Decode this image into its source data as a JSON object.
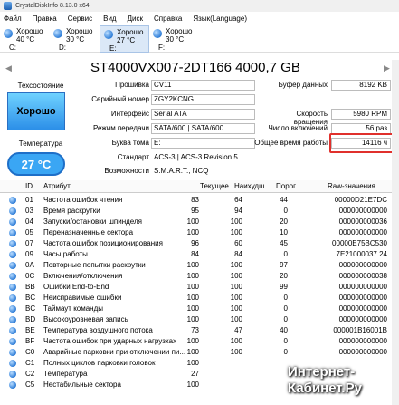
{
  "window": {
    "title": "CrystalDiskInfo 8.13.0 x64"
  },
  "menu": [
    "Файл",
    "Правка",
    "Сервис",
    "Вид",
    "Диск",
    "Справка",
    "Язык(Language)"
  ],
  "drives": [
    {
      "status": "Хорошо",
      "temp": "40 °C",
      "letter": "C:"
    },
    {
      "status": "Хорошо",
      "temp": "30 °C",
      "letter": "D:"
    },
    {
      "status": "Хорошо",
      "temp": "27 °C",
      "letter": "E:"
    },
    {
      "status": "Хорошо",
      "temp": "30 °C",
      "letter": "F:"
    }
  ],
  "model": "ST4000VX007-2DT166 4000,7 GB",
  "health": {
    "label": "Техсостояние",
    "value": "Хорошо"
  },
  "temperature": {
    "label": "Температура",
    "value": "27 °C"
  },
  "info": {
    "firmware_k": "Прошивка",
    "firmware_v": "CV11",
    "serial_k": "Серийный номер",
    "serial_v": "ZGY2KCNG",
    "interface_k": "Интерфейс",
    "interface_v": "Serial ATA",
    "transfer_k": "Режим передачи",
    "transfer_v": "SATA/600 | SATA/600",
    "volume_k": "Буква тома",
    "volume_v": "E:",
    "standard_k": "Стандарт",
    "standard_v": "ACS-3 | ACS-3 Revision 5",
    "features_k": "Возможности",
    "features_v": "S.M.A.R.T., NCQ",
    "buffer_k": "Буфер данных",
    "buffer_v": "8192 KB",
    "rotation_k": "Скорость вращения",
    "rotation_v": "5980 RPM",
    "poweron_k": "Число включений",
    "poweron_v": "56 раз",
    "hours_k": "Общее время работы",
    "hours_v": "14116 ч"
  },
  "table": {
    "headers": {
      "id": "ID",
      "attr": "Атрибут",
      "cur": "Текущее",
      "worst": "Наихудш...",
      "thr": "Порог",
      "raw": "Raw-значения"
    },
    "rows": [
      {
        "id": "01",
        "attr": "Частота ошибок чтения",
        "cur": "83",
        "worst": "64",
        "thr": "44",
        "raw": "00000D21E7DC"
      },
      {
        "id": "03",
        "attr": "Время раскрутки",
        "cur": "95",
        "worst": "94",
        "thr": "0",
        "raw": "000000000000"
      },
      {
        "id": "04",
        "attr": "Запуски/остановки шпинделя",
        "cur": "100",
        "worst": "100",
        "thr": "20",
        "raw": "000000000036"
      },
      {
        "id": "05",
        "attr": "Переназначенные сектора",
        "cur": "100",
        "worst": "100",
        "thr": "10",
        "raw": "000000000000"
      },
      {
        "id": "07",
        "attr": "Частота ошибок позиционирования",
        "cur": "96",
        "worst": "60",
        "thr": "45",
        "raw": "00000E75BC530"
      },
      {
        "id": "09",
        "attr": "Часы работы",
        "cur": "84",
        "worst": "84",
        "thr": "0",
        "raw": "7E21000037 24"
      },
      {
        "id": "0A",
        "attr": "Повторные попытки раскрутки",
        "cur": "100",
        "worst": "100",
        "thr": "97",
        "raw": "000000000000"
      },
      {
        "id": "0C",
        "attr": "Включения/отключения",
        "cur": "100",
        "worst": "100",
        "thr": "20",
        "raw": "000000000038"
      },
      {
        "id": "BB",
        "attr": "Ошибки End-to-End",
        "cur": "100",
        "worst": "100",
        "thr": "99",
        "raw": "000000000000"
      },
      {
        "id": "BC",
        "attr": "Неисправимые ошибки",
        "cur": "100",
        "worst": "100",
        "thr": "0",
        "raw": "000000000000"
      },
      {
        "id": "BC",
        "attr": "Таймаут команды",
        "cur": "100",
        "worst": "100",
        "thr": "0",
        "raw": "000000000000"
      },
      {
        "id": "BD",
        "attr": "Высокоуровневая запись",
        "cur": "100",
        "worst": "100",
        "thr": "0",
        "raw": "000000000000"
      },
      {
        "id": "BE",
        "attr": "Температура воздушного потока",
        "cur": "73",
        "worst": "47",
        "thr": "40",
        "raw": "000001B16001B"
      },
      {
        "id": "BF",
        "attr": "Частота ошибок при ударных нагрузках",
        "cur": "100",
        "worst": "100",
        "thr": "0",
        "raw": "000000000000"
      },
      {
        "id": "C0",
        "attr": "Аварийные парковки при отключении пи...",
        "cur": "100",
        "worst": "100",
        "thr": "0",
        "raw": "000000000000"
      },
      {
        "id": "C1",
        "attr": "Полных циклов парковки головок",
        "cur": "100",
        "worst": "",
        "thr": "",
        "raw": ""
      },
      {
        "id": "C2",
        "attr": "Температура",
        "cur": "27",
        "worst": "",
        "thr": "",
        "raw": ""
      },
      {
        "id": "C5",
        "attr": "Нестабильные сектора",
        "cur": "100",
        "worst": "",
        "thr": "",
        "raw": ""
      }
    ]
  },
  "watermark": {
    "line1": "Интернет-",
    "line2": "Кабинет.Ру"
  }
}
